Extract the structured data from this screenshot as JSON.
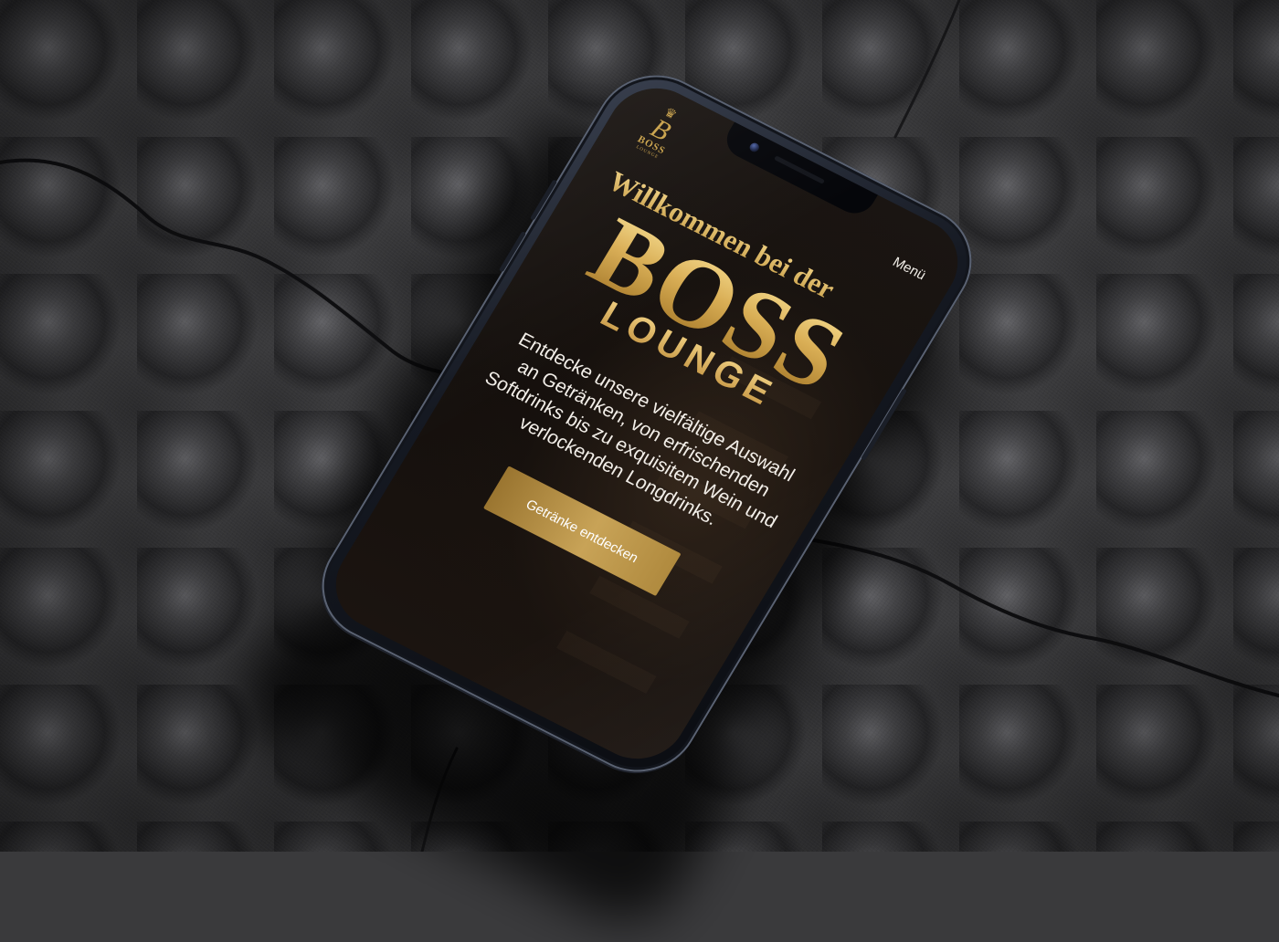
{
  "logo": {
    "crown": "♛",
    "monogram": "B",
    "name": "BOSS",
    "tagline": "LOUNGE"
  },
  "nav": {
    "menu_label": "Menü"
  },
  "hero": {
    "welcome": "Willkommen bei der",
    "brand": "BOSS",
    "brand_sub": "LOUNGE",
    "description": "Entdecke unsere vielfältige Auswahl an Getränken, von erfrischenden Softdrinks bis zu exquisitem Wein und verlockenden Longdrinks.",
    "cta_label": "Getränke entdecken"
  },
  "colors": {
    "gold": "#c9a24a",
    "gold_light": "#f1d488",
    "screen_bg": "#151010",
    "text_light": "#f2eee8"
  },
  "icons": {
    "logo_mark": "crown-icon"
  }
}
